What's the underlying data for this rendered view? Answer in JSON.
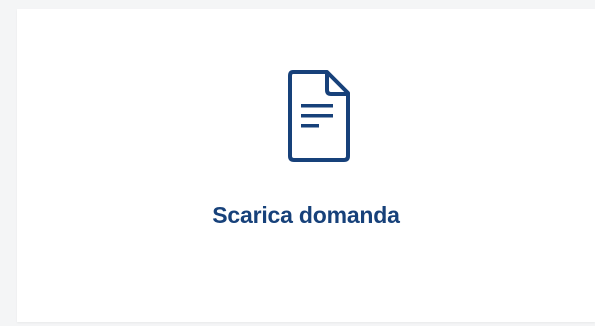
{
  "card": {
    "label": "Scarica domanda",
    "icon": "document-icon"
  },
  "colors": {
    "accent": "#17417a",
    "card_background": "#ffffff",
    "page_background": "#f4f5f6"
  }
}
